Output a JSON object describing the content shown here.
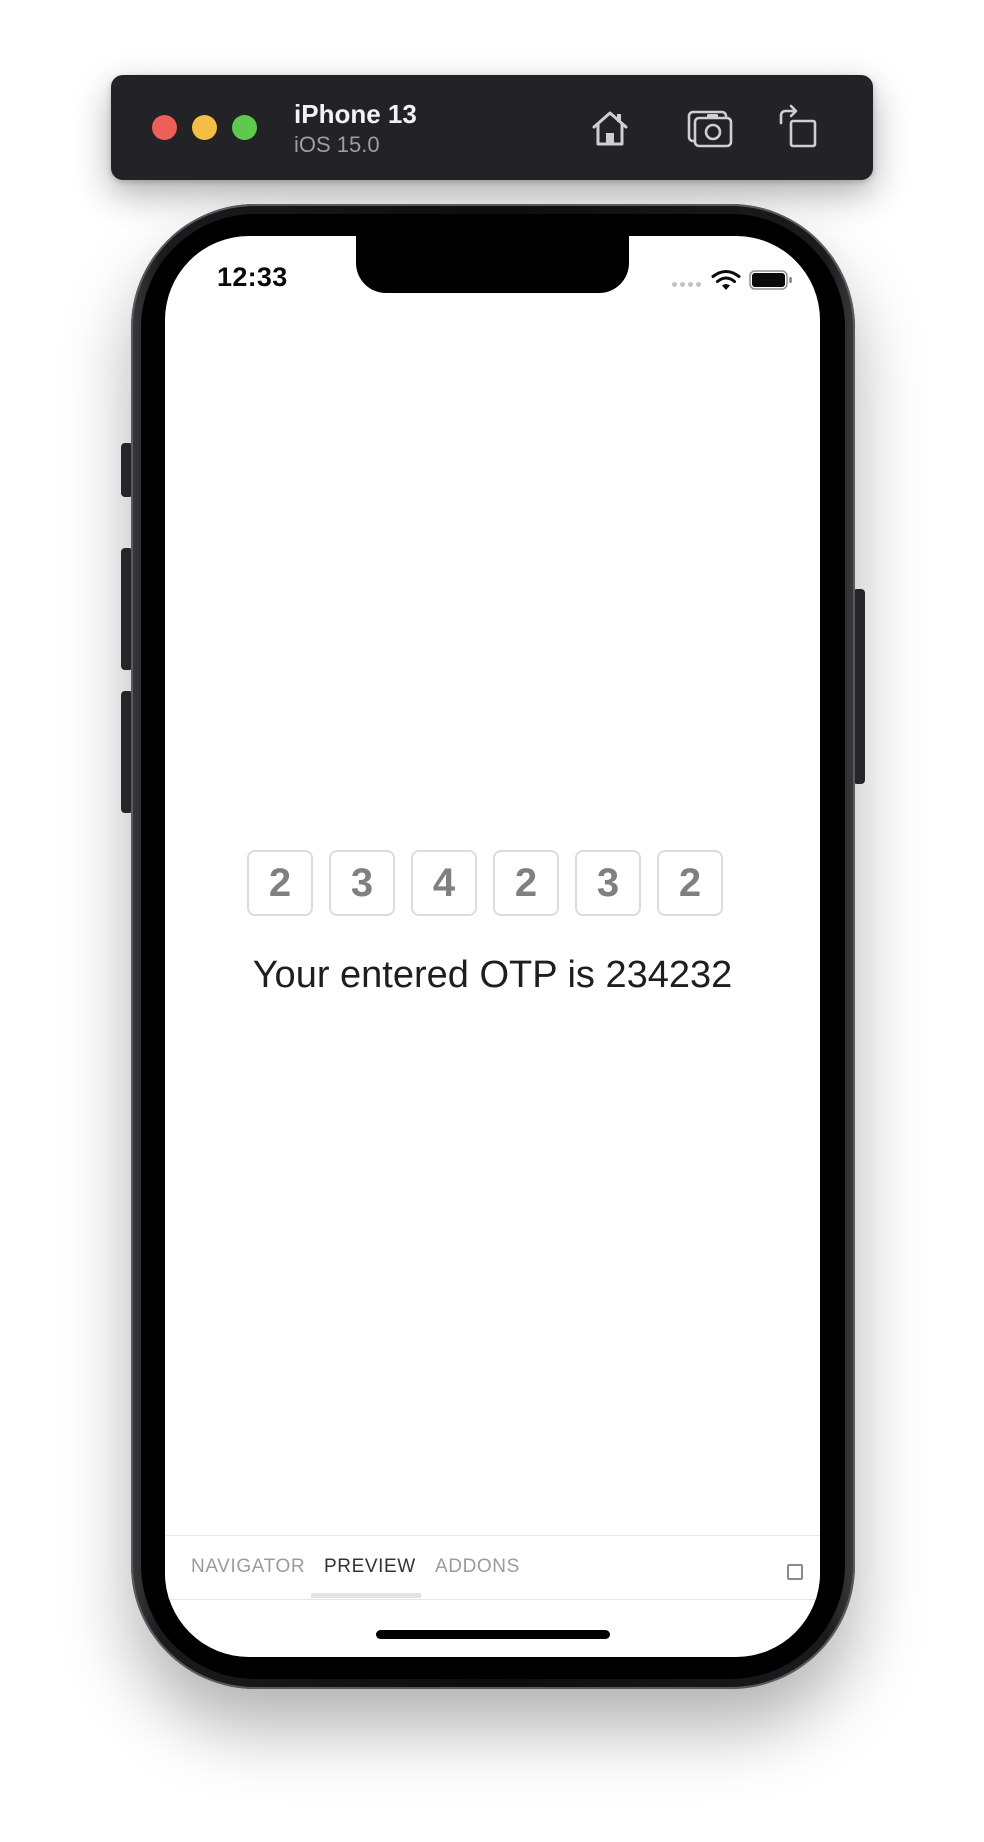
{
  "simulator": {
    "device_name": "iPhone 13",
    "os_version": "iOS 15.0",
    "toolbar_icons": [
      "home-icon",
      "screenshot-icon",
      "rotate-icon"
    ]
  },
  "status_bar": {
    "time": "12:33"
  },
  "otp": {
    "digits": [
      "2",
      "3",
      "4",
      "2",
      "3",
      "2"
    ],
    "message": "Your entered OTP is 234232"
  },
  "addon_bar": {
    "tabs": [
      {
        "label": "NAVIGATOR",
        "active": false
      },
      {
        "label": "PREVIEW",
        "active": true
      },
      {
        "label": "ADDONS",
        "active": false
      }
    ]
  },
  "colors": {
    "toolbar_bg": "#232226",
    "traffic_red": "#ed5f57",
    "traffic_yellow": "#f4bd45",
    "traffic_green": "#5fc84f",
    "otp_digit": "#808080",
    "otp_border": "#dcdcdc"
  }
}
